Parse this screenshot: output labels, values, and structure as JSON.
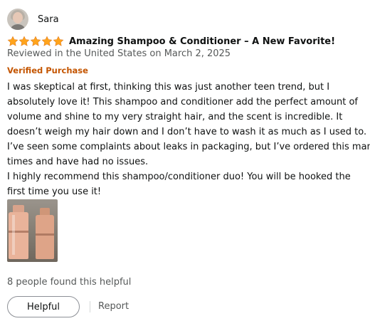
{
  "reviewer": {
    "name": "Sara"
  },
  "rating": {
    "stars": 5,
    "max": 5,
    "color": "#ffa41c"
  },
  "review": {
    "title": "Amazing Shampoo & Conditioner – A New Favorite!",
    "meta": "Reviewed in the United States on March 2, 2025",
    "verified_label": "Verified Purchase",
    "body_lines": [
      "I was skeptical at first, thinking this was just another teen trend, but I",
      "absolutely love it! This shampoo and conditioner add the perfect amount of",
      "volume and shine to my very straight hair, and the scent is incredible. It",
      "doesn’t weigh my hair down and I don’t have to wash it as much as I used to.",
      "I’ve seen some complaints about leaks in packaging, but I’ve ordered this many",
      "times and have had no issues.",
      "I highly recommend this shampoo/conditioner duo! You will be hooked the",
      "first time you use it!"
    ]
  },
  "footer": {
    "helpful_count": "8 people found this helpful",
    "helpful_button": "Helpful",
    "report_link": "Report"
  },
  "colors": {
    "verified": "#c45500",
    "meta": "#565959",
    "text": "#0f1111"
  }
}
